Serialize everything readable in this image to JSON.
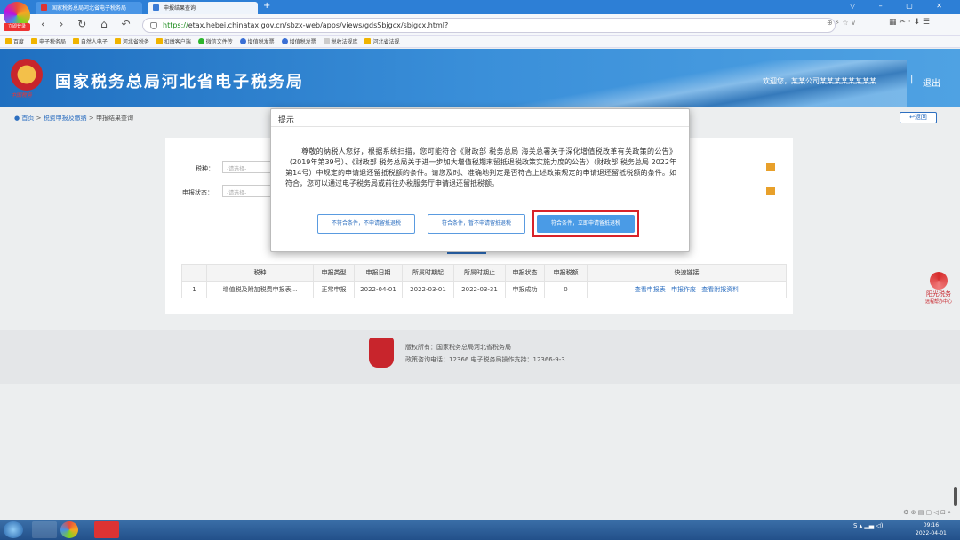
{
  "browser": {
    "tabs": [
      {
        "label": "国家税务总局河北省电子税务局"
      },
      {
        "label": "申报结果查询"
      }
    ],
    "new_tab": "+",
    "logo_badge": "立即登录",
    "nav_icons": "‹ › ↻ ⌂ ↶ ☆",
    "url_prefix": "https://",
    "url_rest": "etax.hebei.chinatax.gov.cn/sbzx-web/apps/views/gdsSbjgcx/sbjgcx.html?",
    "url_icons": "⊕ ⚡ ☆ ∨",
    "right_icons": "▦ ✂ · ⬇ ☰",
    "window_buttons": "▽ – ▢ ✕",
    "bookmarks": [
      "百度",
      "电子税务局",
      "自然人电子",
      "河北省税务",
      "扣缴客户端",
      "微信文件传",
      "增值税发票",
      "增值税发票",
      "税收法规库",
      "河北省法规"
    ]
  },
  "header": {
    "title": "国家税务总局河北省电子税务局",
    "welcome": "欢迎您，某某公司某某某某某某某某",
    "separator": "|",
    "logout": "退出",
    "emblem_text": "中国税务"
  },
  "breadcrumb": {
    "home": "首页",
    "sep": ">",
    "level1": "税费申报及缴纳",
    "level2": "申报结果查询",
    "back_button": "返回"
  },
  "filters": {
    "tax_type_label": "税种：",
    "tax_type_placeholder": "-请选择-",
    "status_label": "申报状态：",
    "status_placeholder": "-请选择-"
  },
  "table": {
    "headers": [
      "",
      "税种",
      "申报类型",
      "申报日期",
      "所属时期起",
      "所属时期止",
      "申报状态",
      "申报税额",
      "快速链接"
    ],
    "rows": [
      {
        "index": "1",
        "tax": "增值税及附加税费申报表...",
        "type": "正常申报",
        "date": "2022-04-01",
        "start": "2022-03-01",
        "end": "2022-03-31",
        "status": "申报成功",
        "amount": "0",
        "links": [
          "查看申报表",
          "申报作废",
          "查看附报资料"
        ]
      }
    ]
  },
  "side_badge": {
    "line1": "阳光税务",
    "line2": "远程帮办中心"
  },
  "footer": {
    "line1": "版权所有：国家税务总局河北省税务局",
    "line2": "政策咨询电话：12366    电子税务局操作支持：12366-9-3"
  },
  "modal": {
    "title": "提示",
    "body": "尊敬的纳税人您好，根据系统扫描，您可能符合《财政部 税务总局 海关总署关于深化增值税改革有关政策的公告》（2019年第39号）、《财政部 税务总局关于进一步加大增值税期末留抵退税政策实施力度的公告》（财政部 税务总局 2022年第14号）中规定的申请退还留抵税额的条件。请您及时、准确地判定是否符合上述政策规定的申请退还留抵税额的条件。如符合，您可以通过电子税务局或前往办税服务厅申请退还留抵税额。",
    "btn_not_qualify": "不符合条件，不申请留抵退税",
    "btn_qualify_later": "符合条件，暂不申请留抵退税",
    "btn_qualify_now": "符合条件，立即申请留抵退税"
  },
  "status_icons": "⚙ ⊕ ▤ ▢ ◁ ⊡ ⌕",
  "taskbar": {
    "tray": "S ▴ ▂▄ ◁)",
    "time": "09:16",
    "date": "2022-04-01"
  },
  "colors": {
    "accent": "#2d6fc0",
    "header": "#2f86d4",
    "highlight": "#d8232a",
    "primary_button": "#4a9be6"
  }
}
